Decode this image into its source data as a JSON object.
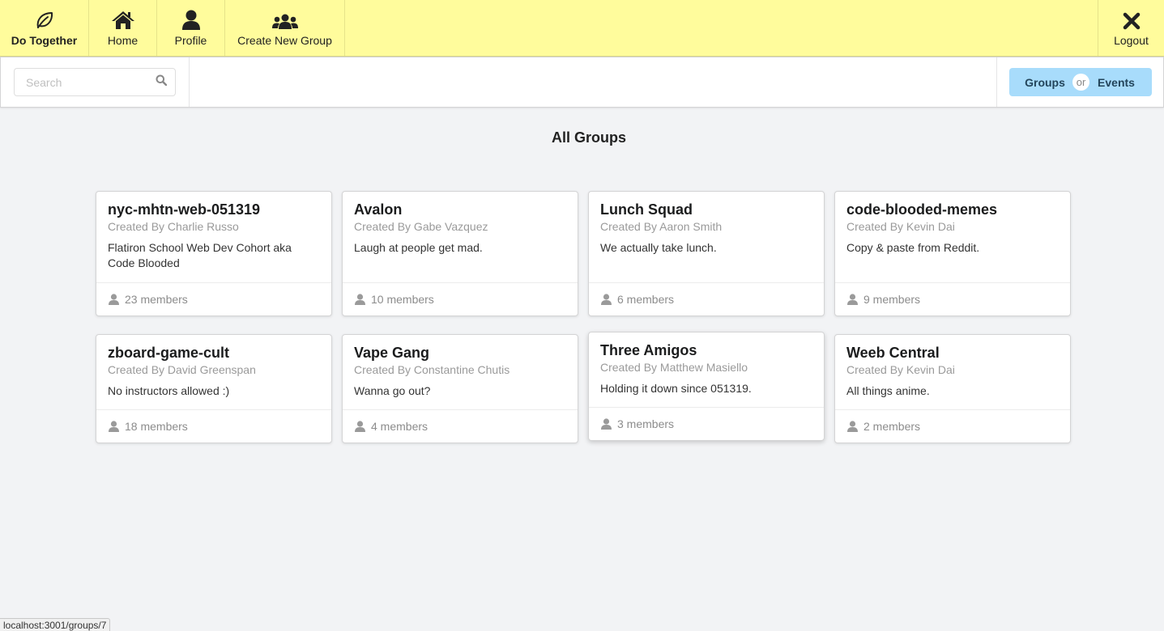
{
  "nav": {
    "brand_label": "Do Together",
    "brand_icon": "leaf-icon",
    "home_label": "Home",
    "profile_label": "Profile",
    "create_label": "Create New Group",
    "logout_label": "Logout"
  },
  "search": {
    "placeholder": "Search",
    "value": ""
  },
  "toggle": {
    "groups_label": "Groups",
    "or_label": "or",
    "events_label": "Events"
  },
  "page_title": "All Groups",
  "groups": [
    {
      "name": "nyc-mhtn-web-051319",
      "created_by": "Created By Charlie Russo",
      "description": "Flatiron School Web Dev Cohort aka Code Blooded",
      "members": "23 members"
    },
    {
      "name": "Avalon",
      "created_by": "Created By Gabe Vazquez",
      "description": "Laugh at people get mad.",
      "members": "10 members"
    },
    {
      "name": "Lunch Squad",
      "created_by": "Created By Aaron Smith",
      "description": "We actually take lunch.",
      "members": "6 members"
    },
    {
      "name": "code-blooded-memes",
      "created_by": "Created By Kevin Dai",
      "description": "Copy & paste from Reddit.",
      "members": "9 members"
    },
    {
      "name": "zboard-game-cult",
      "created_by": "Created By David Greenspan",
      "description": "No instructors allowed :)",
      "members": "18 members"
    },
    {
      "name": "Vape Gang",
      "created_by": "Created By Constantine Chutis",
      "description": "Wanna go out?",
      "members": "4 members"
    },
    {
      "name": "Three Amigos",
      "created_by": "Created By Matthew Masiello",
      "description": "Holding it down since 051319.",
      "members": "3 members"
    },
    {
      "name": "Weeb Central",
      "created_by": "Created By Kevin Dai",
      "description": "All things anime.",
      "members": "2 members"
    }
  ],
  "status_url": "localhost:3001/groups/7",
  "colors": {
    "nav_bg": "#fffc9c",
    "toggle_bg": "#a8dcfb",
    "page_bg": "#f2f3f5"
  }
}
